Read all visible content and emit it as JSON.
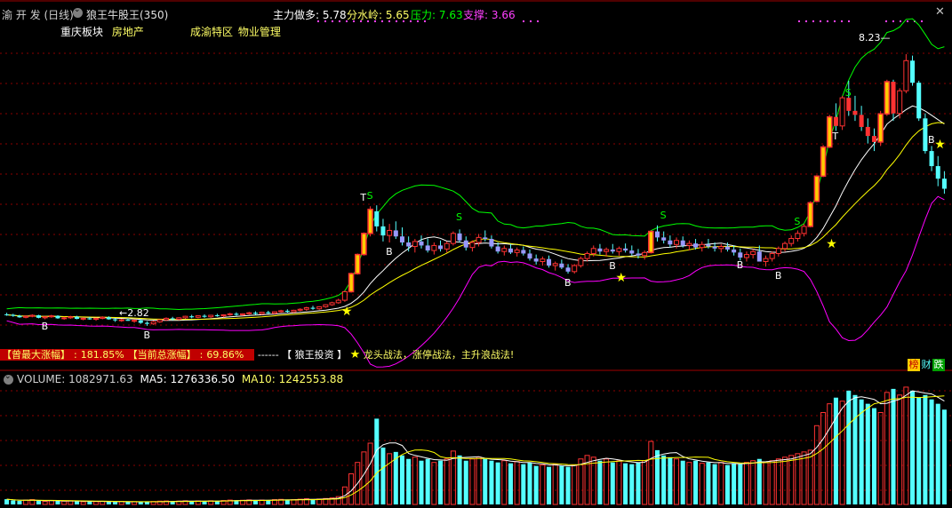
{
  "header": {
    "stock_name": "渝 开 发",
    "period": "(日线)",
    "indicator_name": "狼王牛股王(350)",
    "main_force": {
      "label": "主力做多:",
      "value": "5.78"
    },
    "watershed": {
      "label": "分水岭:",
      "value": "5.65"
    },
    "pressure": {
      "label": "压力:",
      "value": "7.63"
    },
    "support": {
      "label": "支撑:",
      "value": "3.66"
    }
  },
  "tags": {
    "sector_label": "重庆板块",
    "sector_value": "房地产",
    "concept_label": "成渝特区",
    "concept_value": "物业管理"
  },
  "annotations": {
    "peak_price": "8.23",
    "low_price": "2.82",
    "buy_marker": "B",
    "sell_marker": "S",
    "top_marker": "T"
  },
  "info_bar": {
    "max_gain_label": "【曾最大涨幅】",
    "max_gain_value": "181.85%",
    "total_gain_label": "【当前总涨幅】",
    "total_gain_value": "69.86%",
    "sep": "------",
    "brand": "【 狼王投资 】",
    "star_glyph": "★",
    "tagline": "龙头战法，涨停战法，主升浪战法!"
  },
  "badges": {
    "b1": "榜",
    "b2": "财",
    "b3": "跌"
  },
  "volume": {
    "label": "VOLUME:",
    "value": "1082971.63",
    "ma5_label": "MA5:",
    "ma5_value": "1276336.50",
    "ma10_label": "MA10:",
    "ma10_value": "1242553.88"
  },
  "colors": {
    "up": "#ff3232",
    "down": "#54ffff",
    "flat": "#ffffff",
    "ma_white": "#ffffff",
    "ma_yellow": "#ffff00",
    "upper_band": "#00ff00",
    "lower_band": "#ff00ff",
    "limit_up_fill": "#ffcc00"
  },
  "chart_data": {
    "type": "candlestick",
    "price_range": [
      2.5,
      8.6
    ],
    "volume_range": [
      0,
      1400000
    ],
    "candles": [
      [
        3.05,
        3.08,
        3.02,
        3.04
      ],
      [
        3.04,
        3.06,
        3.0,
        3.02
      ],
      [
        3.02,
        3.04,
        2.98,
        2.99
      ],
      [
        2.99,
        3.03,
        2.97,
        3.01
      ],
      [
        3.01,
        3.05,
        2.99,
        3.03
      ],
      [
        3.03,
        3.04,
        2.97,
        2.98
      ],
      [
        2.98,
        3.01,
        2.95,
        3.0
      ],
      [
        3.0,
        3.04,
        2.98,
        3.02
      ],
      [
        3.02,
        3.03,
        2.96,
        2.97
      ],
      [
        2.97,
        3.0,
        2.94,
        2.98
      ],
      [
        2.98,
        3.02,
        2.96,
        3.0
      ],
      [
        3.0,
        3.02,
        2.95,
        2.96
      ],
      [
        2.96,
        2.99,
        2.93,
        2.97
      ],
      [
        2.97,
        3.0,
        2.94,
        2.95
      ],
      [
        2.95,
        2.98,
        2.92,
        2.97
      ],
      [
        2.97,
        3.01,
        2.95,
        2.99
      ],
      [
        2.99,
        3.01,
        2.94,
        2.95
      ],
      [
        2.95,
        2.97,
        2.9,
        2.93
      ],
      [
        2.93,
        2.96,
        2.9,
        2.94
      ],
      [
        2.94,
        2.97,
        2.92,
        2.92
      ],
      [
        2.92,
        2.95,
        2.88,
        2.93
      ],
      [
        2.93,
        2.95,
        2.86,
        2.88
      ],
      [
        2.88,
        2.91,
        2.82,
        2.86
      ],
      [
        2.86,
        2.92,
        2.84,
        2.9
      ],
      [
        2.9,
        2.95,
        2.88,
        2.94
      ],
      [
        2.94,
        2.99,
        2.92,
        2.97
      ],
      [
        2.97,
        3.0,
        2.93,
        2.95
      ],
      [
        2.95,
        2.99,
        2.93,
        2.98
      ],
      [
        2.98,
        3.02,
        2.96,
        3.01
      ],
      [
        3.01,
        3.04,
        2.97,
        2.99
      ],
      [
        2.99,
        3.03,
        2.97,
        3.02
      ],
      [
        3.02,
        3.05,
        2.98,
        3.0
      ],
      [
        3.0,
        3.04,
        2.98,
        3.03
      ],
      [
        3.03,
        3.06,
        3.0,
        3.02
      ],
      [
        3.02,
        3.05,
        2.99,
        3.04
      ],
      [
        3.04,
        3.08,
        3.02,
        3.06
      ],
      [
        3.06,
        3.09,
        3.02,
        3.04
      ],
      [
        3.04,
        3.07,
        3.02,
        3.06
      ],
      [
        3.06,
        3.1,
        3.04,
        3.08
      ],
      [
        3.08,
        3.11,
        3.04,
        3.06
      ],
      [
        3.06,
        3.1,
        3.04,
        3.09
      ],
      [
        3.09,
        3.12,
        3.06,
        3.07
      ],
      [
        3.07,
        3.11,
        3.05,
        3.1
      ],
      [
        3.1,
        3.14,
        3.08,
        3.12
      ],
      [
        3.12,
        3.15,
        3.08,
        3.1
      ],
      [
        3.1,
        3.14,
        3.08,
        3.13
      ],
      [
        3.13,
        3.17,
        3.11,
        3.15
      ],
      [
        3.15,
        3.2,
        3.12,
        3.18
      ],
      [
        3.18,
        3.22,
        3.14,
        3.16
      ],
      [
        3.16,
        3.21,
        3.14,
        3.2
      ],
      [
        3.2,
        3.25,
        3.18,
        3.24
      ],
      [
        3.24,
        3.3,
        3.22,
        3.28
      ],
      [
        3.28,
        3.36,
        3.26,
        3.33
      ],
      [
        3.33,
        3.52,
        3.3,
        3.5
      ],
      [
        3.5,
        3.88,
        3.48,
        3.86
      ],
      [
        3.86,
        4.26,
        3.84,
        4.24
      ],
      [
        4.24,
        4.68,
        4.22,
        4.66
      ],
      [
        4.66,
        5.2,
        4.6,
        5.14
      ],
      [
        5.1,
        5.22,
        4.7,
        4.8
      ],
      [
        4.8,
        4.95,
        4.5,
        4.62
      ],
      [
        4.62,
        4.85,
        4.48,
        4.72
      ],
      [
        4.72,
        4.9,
        4.55,
        4.6
      ],
      [
        4.6,
        4.78,
        4.42,
        4.48
      ],
      [
        4.48,
        4.6,
        4.3,
        4.4
      ],
      [
        4.4,
        4.55,
        4.28,
        4.5
      ],
      [
        4.5,
        4.62,
        4.36,
        4.42
      ],
      [
        4.42,
        4.56,
        4.28,
        4.32
      ],
      [
        4.32,
        4.48,
        4.24,
        4.42
      ],
      [
        4.42,
        4.52,
        4.3,
        4.35
      ],
      [
        4.35,
        4.5,
        4.28,
        4.46
      ],
      [
        4.46,
        4.7,
        4.42,
        4.66
      ],
      [
        4.66,
        4.74,
        4.48,
        4.52
      ],
      [
        4.52,
        4.6,
        4.32,
        4.38
      ],
      [
        4.38,
        4.52,
        4.3,
        4.48
      ],
      [
        4.48,
        4.65,
        4.4,
        4.58
      ],
      [
        4.58,
        4.72,
        4.5,
        4.55
      ],
      [
        4.55,
        4.62,
        4.36,
        4.4
      ],
      [
        4.4,
        4.48,
        4.26,
        4.3
      ],
      [
        4.3,
        4.42,
        4.22,
        4.36
      ],
      [
        4.36,
        4.45,
        4.25,
        4.28
      ],
      [
        4.28,
        4.38,
        4.2,
        4.33
      ],
      [
        4.33,
        4.4,
        4.22,
        4.26
      ],
      [
        4.26,
        4.34,
        4.12,
        4.16
      ],
      [
        4.16,
        4.24,
        4.04,
        4.1
      ],
      [
        4.1,
        4.2,
        4.02,
        4.15
      ],
      [
        4.15,
        4.22,
        3.98,
        4.02
      ],
      [
        4.02,
        4.1,
        3.92,
        4.06
      ],
      [
        4.06,
        4.14,
        3.95,
        3.98
      ],
      [
        3.98,
        4.05,
        3.86,
        3.9
      ],
      [
        3.9,
        4.05,
        3.86,
        4.02
      ],
      [
        4.02,
        4.2,
        3.98,
        4.16
      ],
      [
        4.16,
        4.3,
        4.1,
        4.26
      ],
      [
        4.26,
        4.42,
        4.2,
        4.36
      ],
      [
        4.36,
        4.45,
        4.24,
        4.3
      ],
      [
        4.3,
        4.38,
        4.2,
        4.34
      ],
      [
        4.34,
        4.45,
        4.26,
        4.3
      ],
      [
        4.3,
        4.4,
        4.22,
        4.36
      ],
      [
        4.36,
        4.46,
        4.28,
        4.32
      ],
      [
        4.32,
        4.42,
        4.22,
        4.26
      ],
      [
        4.26,
        4.35,
        4.16,
        4.22
      ],
      [
        4.22,
        4.32,
        4.14,
        4.28
      ],
      [
        4.28,
        4.72,
        4.26,
        4.7
      ],
      [
        4.7,
        4.82,
        4.5,
        4.58
      ],
      [
        4.58,
        4.7,
        4.46,
        4.52
      ],
      [
        4.52,
        4.62,
        4.38,
        4.44
      ],
      [
        4.44,
        4.58,
        4.36,
        4.52
      ],
      [
        4.52,
        4.6,
        4.38,
        4.42
      ],
      [
        4.42,
        4.52,
        4.32,
        4.46
      ],
      [
        4.46,
        4.55,
        4.34,
        4.38
      ],
      [
        4.38,
        4.5,
        4.3,
        4.44
      ],
      [
        4.44,
        4.55,
        4.36,
        4.4
      ],
      [
        4.4,
        4.48,
        4.3,
        4.36
      ],
      [
        4.36,
        4.45,
        4.28,
        4.4
      ],
      [
        4.4,
        4.48,
        4.3,
        4.34
      ],
      [
        4.34,
        4.42,
        4.22,
        4.28
      ],
      [
        4.28,
        4.36,
        4.12,
        4.18
      ],
      [
        4.18,
        4.3,
        4.1,
        4.24
      ],
      [
        4.24,
        4.35,
        4.16,
        4.3
      ],
      [
        4.3,
        4.42,
        4.22,
        4.1
      ],
      [
        4.1,
        4.22,
        4.0,
        4.16
      ],
      [
        4.16,
        4.3,
        4.1,
        4.26
      ],
      [
        4.26,
        4.4,
        4.2,
        4.36
      ],
      [
        4.36,
        4.5,
        4.3,
        4.46
      ],
      [
        4.46,
        4.62,
        4.4,
        4.56
      ],
      [
        4.56,
        4.72,
        4.5,
        4.66
      ],
      [
        4.66,
        4.85,
        4.6,
        4.8
      ],
      [
        4.8,
        5.3,
        4.78,
        5.27
      ],
      [
        5.3,
        5.82,
        5.28,
        5.8
      ],
      [
        5.8,
        6.42,
        5.78,
        6.38
      ],
      [
        6.38,
        7.02,
        6.36,
        6.98
      ],
      [
        6.98,
        7.25,
        6.7,
        6.8
      ],
      [
        6.8,
        7.4,
        6.72,
        7.36
      ],
      [
        7.36,
        7.7,
        7.0,
        7.1
      ],
      [
        7.1,
        7.4,
        6.9,
        7.02
      ],
      [
        7.02,
        7.2,
        6.7,
        6.78
      ],
      [
        6.78,
        6.95,
        6.45,
        6.6
      ],
      [
        6.6,
        6.75,
        6.3,
        6.48
      ],
      [
        6.48,
        7.1,
        6.4,
        7.04
      ],
      [
        7.04,
        7.72,
        7.0,
        7.68
      ],
      [
        7.68,
        7.72,
        6.9,
        7.05
      ],
      [
        7.05,
        7.55,
        6.95,
        7.5
      ],
      [
        7.5,
        8.23,
        7.45,
        8.1
      ],
      [
        8.1,
        8.2,
        7.6,
        7.66
      ],
      [
        7.66,
        7.7,
        6.9,
        6.95
      ],
      [
        6.95,
        7.05,
        6.25,
        6.3
      ],
      [
        6.3,
        6.4,
        5.9,
        6.0
      ],
      [
        6.0,
        6.2,
        5.6,
        5.75
      ],
      [
        5.75,
        5.9,
        5.45,
        5.55
      ]
    ],
    "volumes": [
      60,
      45,
      40,
      50,
      55,
      40,
      35,
      45,
      40,
      38,
      42,
      35,
      30,
      38,
      32,
      36,
      30,
      28,
      34,
      30,
      32,
      28,
      26,
      34,
      38,
      40,
      35,
      38,
      42,
      36,
      40,
      35,
      42,
      38,
      45,
      50,
      46,
      48,
      52,
      46,
      50,
      48,
      55,
      58,
      52,
      55,
      60,
      65,
      58,
      62,
      68,
      75,
      90,
      200,
      350,
      480,
      600,
      700,
      980,
      650,
      580,
      600,
      560,
      520,
      540,
      500,
      520,
      480,
      500,
      520,
      610,
      560,
      500,
      520,
      540,
      520,
      500,
      480,
      500,
      470,
      490,
      460,
      480,
      440,
      450,
      430,
      460,
      440,
      430,
      450,
      520,
      560,
      540,
      500,
      520,
      480,
      500,
      470,
      460,
      480,
      500,
      720,
      620,
      560,
      540,
      520,
      500,
      480,
      500,
      470,
      480,
      460,
      480,
      450,
      470,
      460,
      480,
      500,
      520,
      480,
      500,
      520,
      540,
      560,
      580,
      600,
      620,
      900,
      1050,
      1150,
      1220,
      1180,
      1300,
      1250,
      1200,
      1150,
      1100,
      1050,
      1280,
      1320,
      1250,
      1340,
      1300,
      1220,
      1250,
      1200,
      1150,
      1083
    ]
  }
}
